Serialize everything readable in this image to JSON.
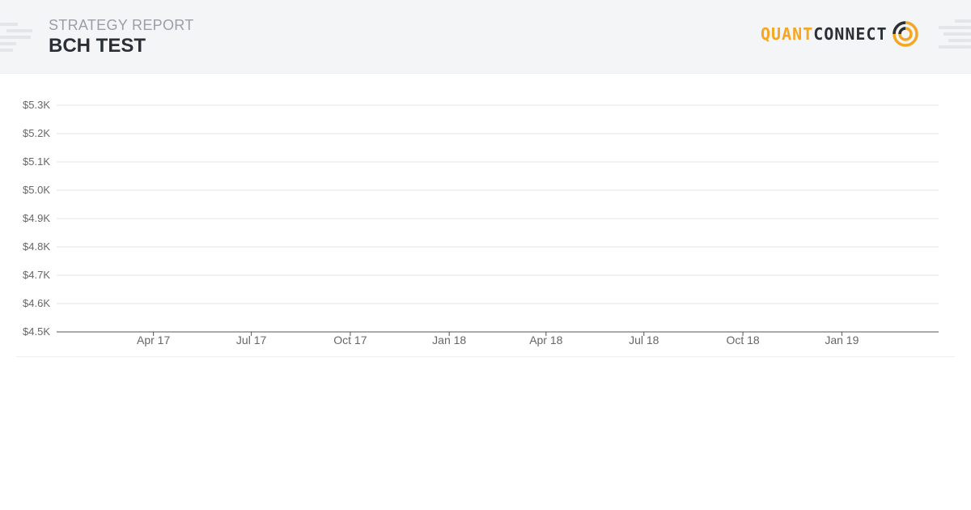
{
  "header": {
    "subtitle": "STRATEGY REPORT",
    "title": "BCH TEST",
    "logo": {
      "part1": "QUANT",
      "part2": "CONNECT",
      "icon": "quantconnect-logo-icon",
      "accent": "#f5a623"
    }
  },
  "chart_data": {
    "type": "line",
    "title": "",
    "xlabel": "",
    "ylabel": "",
    "ylim": [
      4500,
      5300
    ],
    "y_ticks": [
      {
        "value": 5300,
        "label": "$5.3K"
      },
      {
        "value": 5200,
        "label": "$5.2K"
      },
      {
        "value": 5100,
        "label": "$5.1K"
      },
      {
        "value": 5000,
        "label": "$5.0K"
      },
      {
        "value": 4900,
        "label": "$4.9K"
      },
      {
        "value": 4800,
        "label": "$4.8K"
      },
      {
        "value": 4700,
        "label": "$4.7K"
      },
      {
        "value": 4600,
        "label": "$4.6K"
      },
      {
        "value": 4500,
        "label": "$4.5K"
      }
    ],
    "xlim": [
      "2017-01-01",
      "2019-04-01"
    ],
    "x_ticks": [
      {
        "value": "2017-04-01",
        "label": "Apr 17"
      },
      {
        "value": "2017-07-01",
        "label": "Jul 17"
      },
      {
        "value": "2017-10-01",
        "label": "Oct 17"
      },
      {
        "value": "2018-01-01",
        "label": "Jan 18"
      },
      {
        "value": "2018-04-01",
        "label": "Apr 18"
      },
      {
        "value": "2018-07-01",
        "label": "Jul 18"
      },
      {
        "value": "2018-10-01",
        "label": "Oct 18"
      },
      {
        "value": "2019-01-01",
        "label": "Jan 19"
      }
    ],
    "series": [],
    "grid": true,
    "colors": {
      "grid": "#e3e5ea",
      "axis": "#555555",
      "tick_label": "#666666"
    }
  }
}
